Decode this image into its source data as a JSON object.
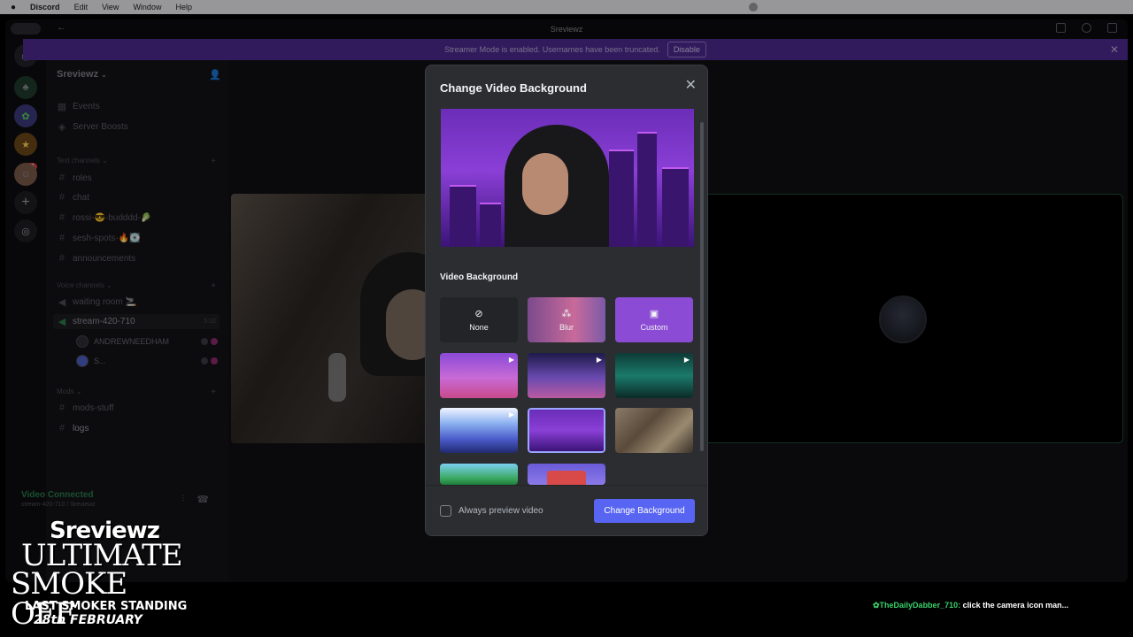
{
  "menubar": {
    "apple": "",
    "app": "Discord",
    "items": [
      "Edit",
      "View",
      "Window",
      "Help"
    ]
  },
  "window": {
    "title": "Sreviewz"
  },
  "banner": {
    "text": "Streamer Mode is enabled. Usernames have been truncated.",
    "disable_label": "Disable"
  },
  "rail": {
    "badge": "86"
  },
  "sidebar": {
    "server_name": "Sreviewz",
    "top_items": [
      {
        "label": "Events"
      },
      {
        "label": "Server Boosts"
      }
    ],
    "text_category": "Text channels",
    "text_channels": [
      "roles",
      "chat",
      "rossi-😎-budddd-🥬",
      "sesh-spots-🔥💽",
      "announcements"
    ],
    "voice_category": "Voice channels",
    "voice_channels": [
      {
        "label": "waiting room 🚬"
      },
      {
        "label": "stream-420-710",
        "time": "5:32"
      }
    ],
    "voice_users": [
      {
        "name": "ANDREWNEEDHAM"
      },
      {
        "name": "S..."
      }
    ],
    "mods_category": "Mods",
    "mods_channels": [
      "mods-stuff",
      "logs"
    ]
  },
  "voice_panel": {
    "title": "Video Connected",
    "subtitle": "stream-420-710 / Sreviewz"
  },
  "modal": {
    "title": "Change Video Background",
    "section_label": "Video Background",
    "options": {
      "none": "None",
      "blur": "Blur",
      "custom": "Custom"
    },
    "checkbox_label": "Always preview video",
    "primary_button": "Change Background",
    "selected_background": 5
  },
  "promo": {
    "name": "Sreviewz",
    "line1": "ULTIMATE",
    "line2": "SMOKE OFF",
    "line3": "LAST SMOKER STANDING",
    "date": "28th FEBRUARY"
  },
  "chat": {
    "user": "TheDailyDabber_710:",
    "message": "click the camera icon man..."
  },
  "colors": {
    "accent": "#5865f2",
    "banner": "#4e2a8f",
    "connected": "#2b7a49",
    "chat_user": "#38d26a"
  }
}
